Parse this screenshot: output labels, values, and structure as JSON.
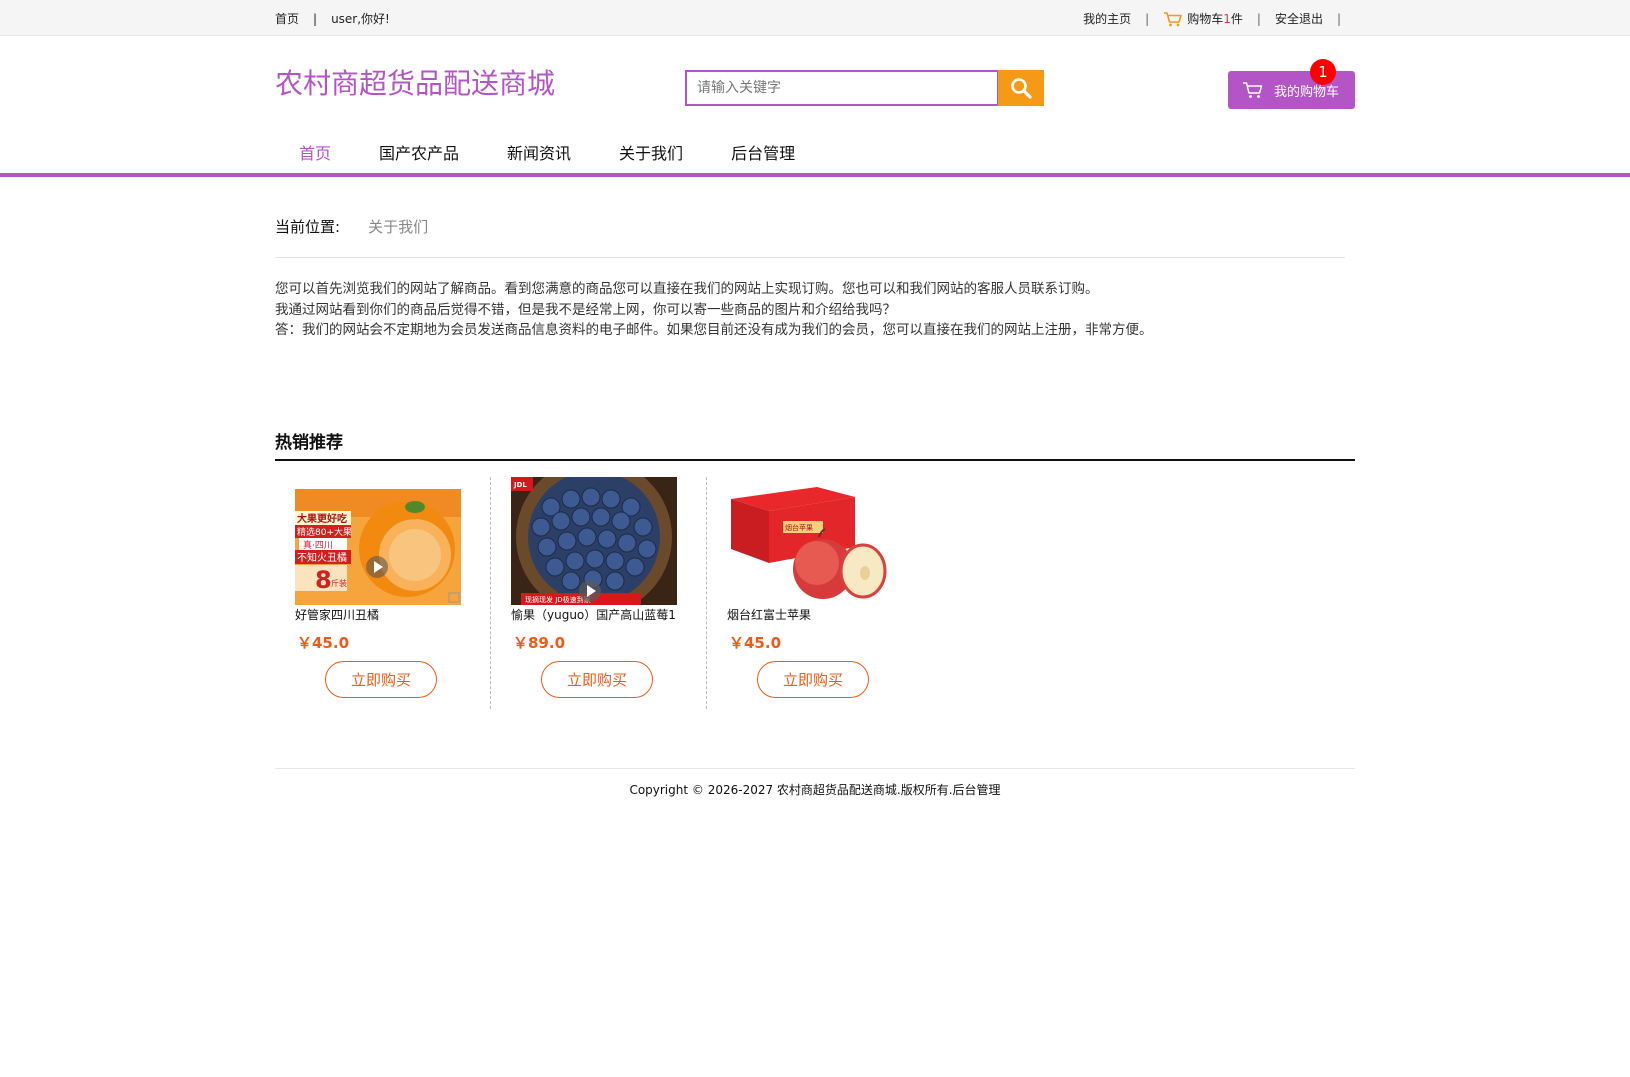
{
  "topbar": {
    "home": "首页",
    "greeting": "user,你好!",
    "my_home": "我的主页",
    "cart_prefix": "购物车",
    "cart_count": "1",
    "cart_suffix": "件",
    "logout": "安全退出",
    "sep": "|"
  },
  "header": {
    "logo": "农村商超货品配送商城",
    "search_placeholder": "请输入关键字",
    "my_cart": "我的购物车",
    "cart_badge": "1"
  },
  "nav": {
    "items": [
      "首页",
      "国产农产品",
      "新闻资讯",
      "关于我们",
      "后台管理"
    ],
    "active_index": 0
  },
  "breadcrumb": {
    "label": "当前位置:",
    "value": "关于我们"
  },
  "content": {
    "lines": [
      "您可以首先浏览我们的网站了解商品。看到您满意的商品您可以直接在我们的网站上实现订购。您也可以和我们网站的客服人员联系订购。",
      "我通过网站看到你们的商品后觉得不错，但是我不是经常上网，你可以寄一些商品的图片和介绍给我吗？",
      "答：我们的网站会不定期地为会员发送商品信息资料的电子邮件。如果您目前还没有成为我们的会员，您可以直接在我们的网站上注册，非常方便。"
    ]
  },
  "hot": {
    "title": "热销推荐",
    "products": [
      {
        "name": "好管家四川丑橘",
        "price": "￥45.0",
        "buy": "立即购买",
        "img": "orange"
      },
      {
        "name": "愉果（yuguo）国产高山蓝莓1",
        "price": "￥89.0",
        "buy": "立即购买",
        "img": "blueberry"
      },
      {
        "name": "烟台红富士苹果",
        "price": "￥45.0",
        "buy": "立即购买",
        "img": "apple"
      }
    ],
    "orange_img_text": [
      "大果更好吃",
      "精选80+大果",
      "真·四川",
      "不知火丑橘",
      "8",
      "斤装"
    ],
    "blueberry_img_text": [
      "JDL",
      "现摘现发 JD极速到家"
    ],
    "apple_img_text": [
      "烟台苹果"
    ]
  },
  "footer": {
    "text": "Copyright © 2026-2027 农村商超货品配送商城.版权所有.后台管理"
  },
  "colors": {
    "brand": "#b455c7",
    "search_btn": "#f59a16",
    "price": "#f25a16",
    "badge": "#ff0000"
  }
}
